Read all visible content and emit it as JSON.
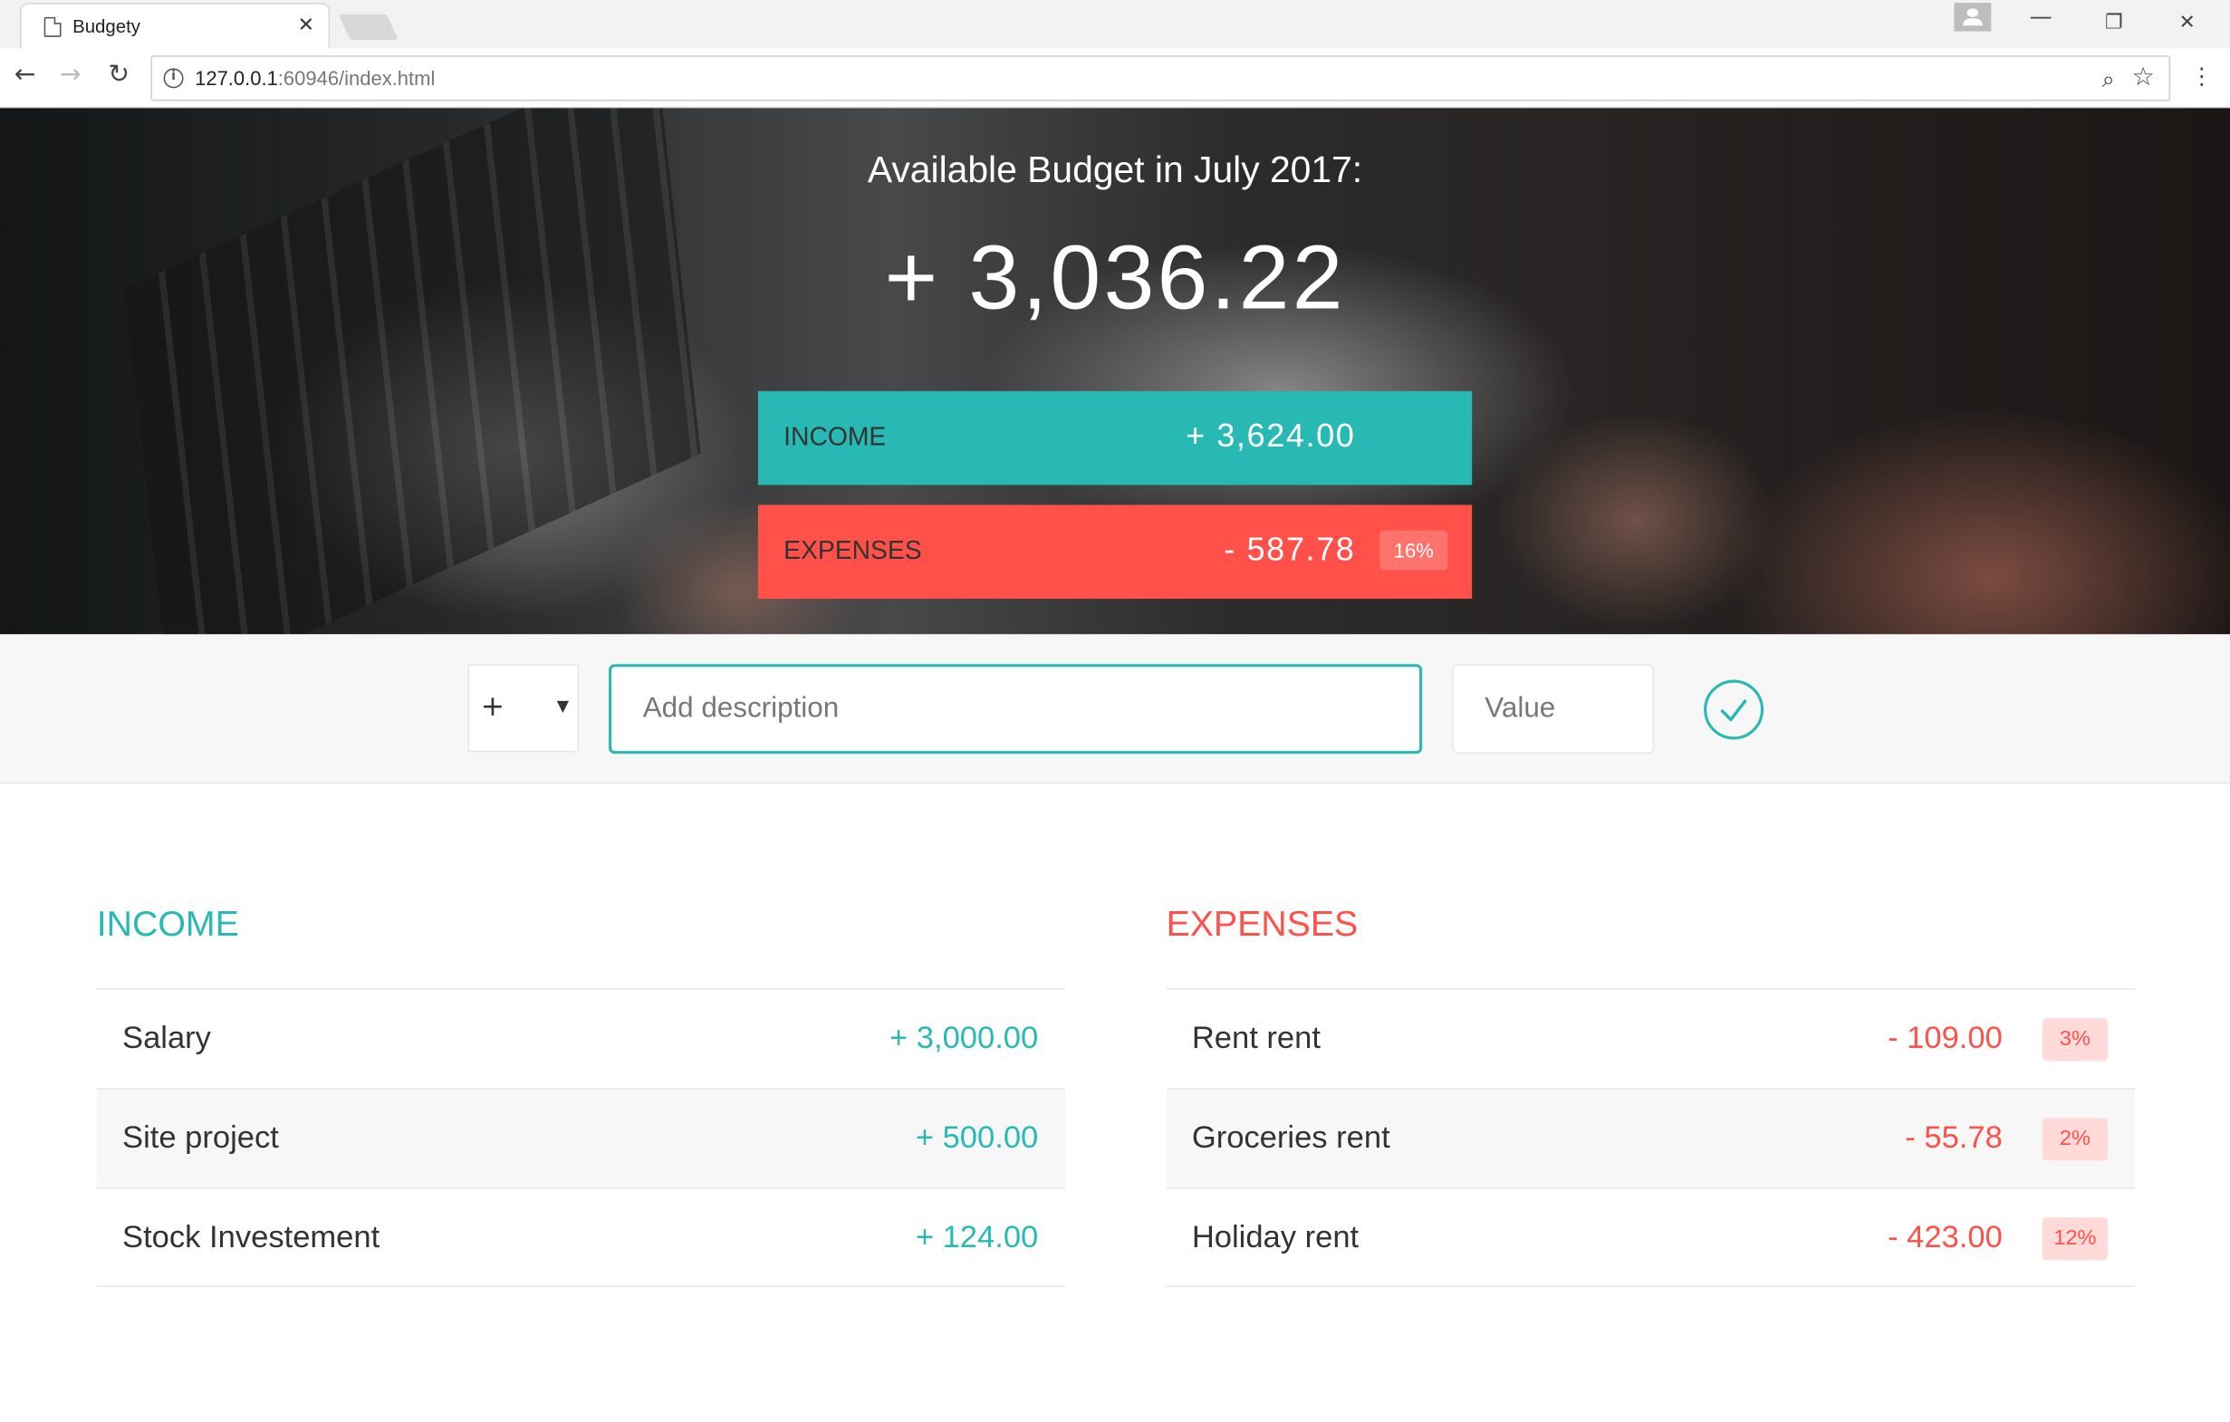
{
  "browser": {
    "tab_title": "Budgety",
    "tab_close": "✕",
    "url_host": "127.0.0.1",
    "url_path": ":60946/index.html"
  },
  "top": {
    "title": "Available Budget in July 2017:",
    "budget_value": "+ 3,036.22",
    "income_label": "INCOME",
    "income_value": "+ 3,624.00",
    "expenses_label": "EXPENSES",
    "expenses_value": "- 587.78",
    "expenses_percentage": "16%"
  },
  "add": {
    "type_selected": "+",
    "description_placeholder": "Add description",
    "value_placeholder": "Value"
  },
  "income": {
    "title": "INCOME",
    "items": [
      {
        "description": "Salary",
        "value": "+ 3,000.00"
      },
      {
        "description": "Site project",
        "value": "+ 500.00"
      },
      {
        "description": "Stock Investement",
        "value": "+ 124.00"
      }
    ]
  },
  "expenses": {
    "title": "EXPENSES",
    "items": [
      {
        "description": "Rent rent",
        "value": "- 109.00",
        "percentage": "3%"
      },
      {
        "description": "Groceries rent",
        "value": "- 55.78",
        "percentage": "2%"
      },
      {
        "description": "Holiday rent",
        "value": "- 423.00",
        "percentage": "12%"
      }
    ]
  },
  "colors": {
    "income": "#28b9b5",
    "expense": "#ff5049"
  }
}
